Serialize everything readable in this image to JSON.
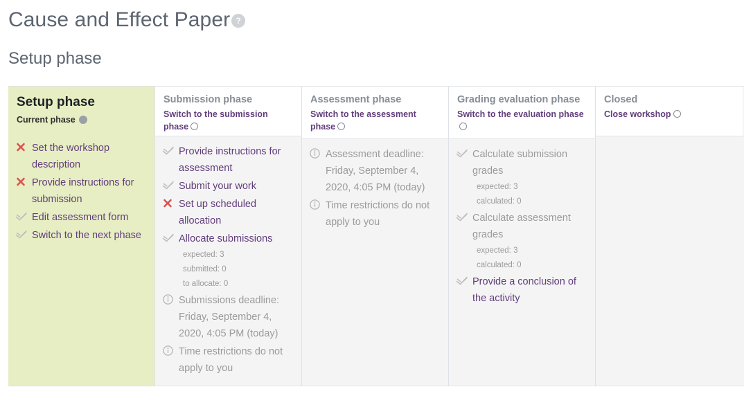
{
  "header": {
    "title": "Cause and Effect Paper",
    "help_icon": "help-icon",
    "help_label": "?",
    "section_title": "Setup phase"
  },
  "phases": [
    {
      "id": "setup",
      "title": "Setup phase",
      "switch_label": "Current phase",
      "marker": "filled-dot",
      "current": true,
      "tasks": [
        {
          "icon": "cross-icon",
          "state": "todo",
          "label": "Set the workshop description",
          "details": []
        },
        {
          "icon": "cross-icon",
          "state": "todo",
          "label": "Provide instructions for submission",
          "details": []
        },
        {
          "icon": "check-icon",
          "state": "done",
          "label": "Edit assessment form",
          "details": []
        },
        {
          "icon": "check-icon",
          "state": "done",
          "label": "Switch to the next phase",
          "details": []
        }
      ]
    },
    {
      "id": "submission",
      "title": "Submission phase",
      "switch_label": "Switch to the submission phase",
      "marker": "open-circle",
      "current": false,
      "tasks": [
        {
          "icon": "check-icon",
          "state": "done",
          "label": "Provide instructions for assessment",
          "details": []
        },
        {
          "icon": "check-icon",
          "state": "done",
          "label": "Submit your work",
          "details": []
        },
        {
          "icon": "cross-icon",
          "state": "todo",
          "label": "Set up scheduled allocation",
          "details": []
        },
        {
          "icon": "check-icon",
          "state": "done",
          "label": "Allocate submissions",
          "details": [
            "expected: 3",
            "submitted: 0",
            "to allocate: 0"
          ]
        },
        {
          "icon": "info-icon",
          "state": "info",
          "label": "Submissions deadline: Friday, September 4, 2020, 4:05 PM (today)",
          "details": []
        },
        {
          "icon": "info-icon",
          "state": "info",
          "label": "Time restrictions do not apply to you",
          "details": []
        }
      ]
    },
    {
      "id": "assessment",
      "title": "Assessment phase",
      "switch_label": "Switch to the assessment phase",
      "marker": "open-circle",
      "current": false,
      "tasks": [
        {
          "icon": "info-icon",
          "state": "info",
          "label": "Assessment deadline: Friday, September 4, 2020, 4:05 PM (today)",
          "details": []
        },
        {
          "icon": "info-icon",
          "state": "info",
          "label": "Time restrictions do not apply to you",
          "details": []
        }
      ]
    },
    {
      "id": "grading-evaluation",
      "title": "Grading evaluation phase",
      "switch_label": "Switch to the evaluation phase",
      "marker": "open-circle",
      "current": false,
      "tasks": [
        {
          "icon": "check-icon",
          "state": "muted",
          "label": "Calculate submission grades",
          "details": [
            "expected: 3",
            "calculated: 0"
          ]
        },
        {
          "icon": "check-icon",
          "state": "muted",
          "label": "Calculate assessment grades",
          "details": [
            "expected: 3",
            "calculated: 0"
          ]
        },
        {
          "icon": "check-icon",
          "state": "done",
          "label": "Provide a conclusion of the activity",
          "details": []
        }
      ]
    },
    {
      "id": "closed",
      "title": "Closed",
      "switch_label": "Close workshop",
      "marker": "open-circle",
      "current": false,
      "tasks": []
    }
  ],
  "colors": {
    "current_phase_bg": "#e7eec4",
    "cell_bg": "#f4f4f4",
    "link": "#613d7c",
    "muted_text": "#9b9b9b",
    "heading": "#5d6571",
    "cross": "#d9534f",
    "border": "#dee2e6"
  }
}
